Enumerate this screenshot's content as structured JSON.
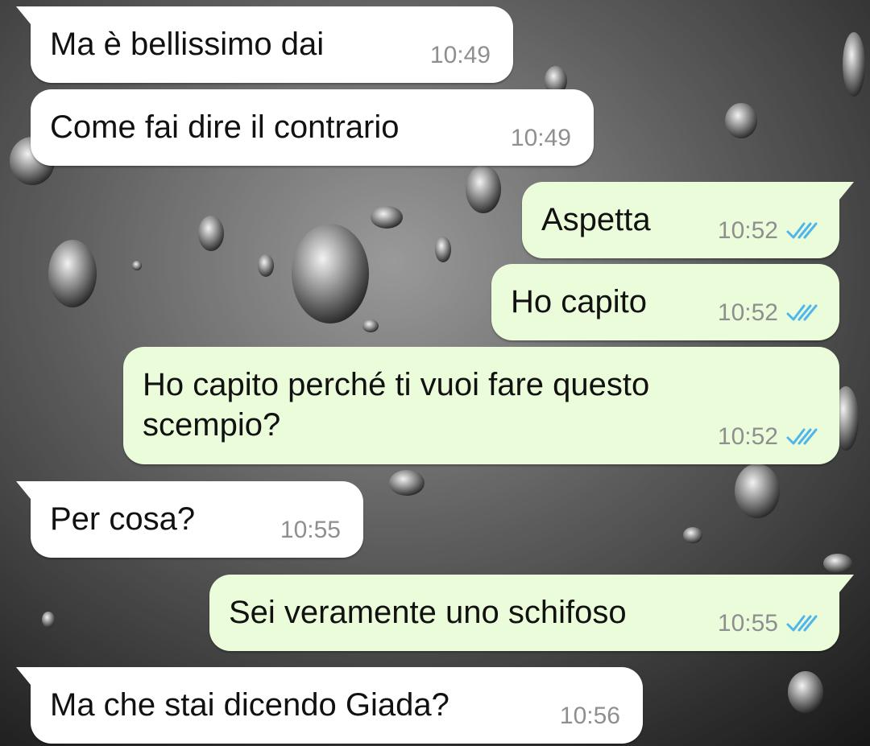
{
  "colors": {
    "incoming_bubble": "#ffffff",
    "outgoing_bubble": "#ebfcda",
    "text": "#111111",
    "time": "#8f8f8f",
    "read_ticks": "#4fb6ec"
  },
  "messages": [
    {
      "direction": "incoming",
      "text": "Ma è bellissimo dai",
      "time": "10:49",
      "status_icon": "none"
    },
    {
      "direction": "incoming",
      "text": "Come fai dire il contrario",
      "time": "10:49",
      "status_icon": "none"
    },
    {
      "direction": "outgoing",
      "text": "Aspetta",
      "time": "10:52",
      "status_icon": "double-check-read-icon"
    },
    {
      "direction": "outgoing",
      "text": "Ho capito",
      "time": "10:52",
      "status_icon": "double-check-read-icon"
    },
    {
      "direction": "outgoing",
      "text": "Ho capito perché ti vuoi fare questo scempio?",
      "time": "10:52",
      "status_icon": "double-check-read-icon"
    },
    {
      "direction": "incoming",
      "text": "Per cosa?",
      "time": "10:55",
      "status_icon": "none"
    },
    {
      "direction": "outgoing",
      "text": "Sei veramente uno schifoso",
      "time": "10:55",
      "status_icon": "double-check-read-icon"
    },
    {
      "direction": "incoming",
      "text": "Ma che stai dicendo Giada?",
      "time": "10:56",
      "status_icon": "none"
    }
  ]
}
